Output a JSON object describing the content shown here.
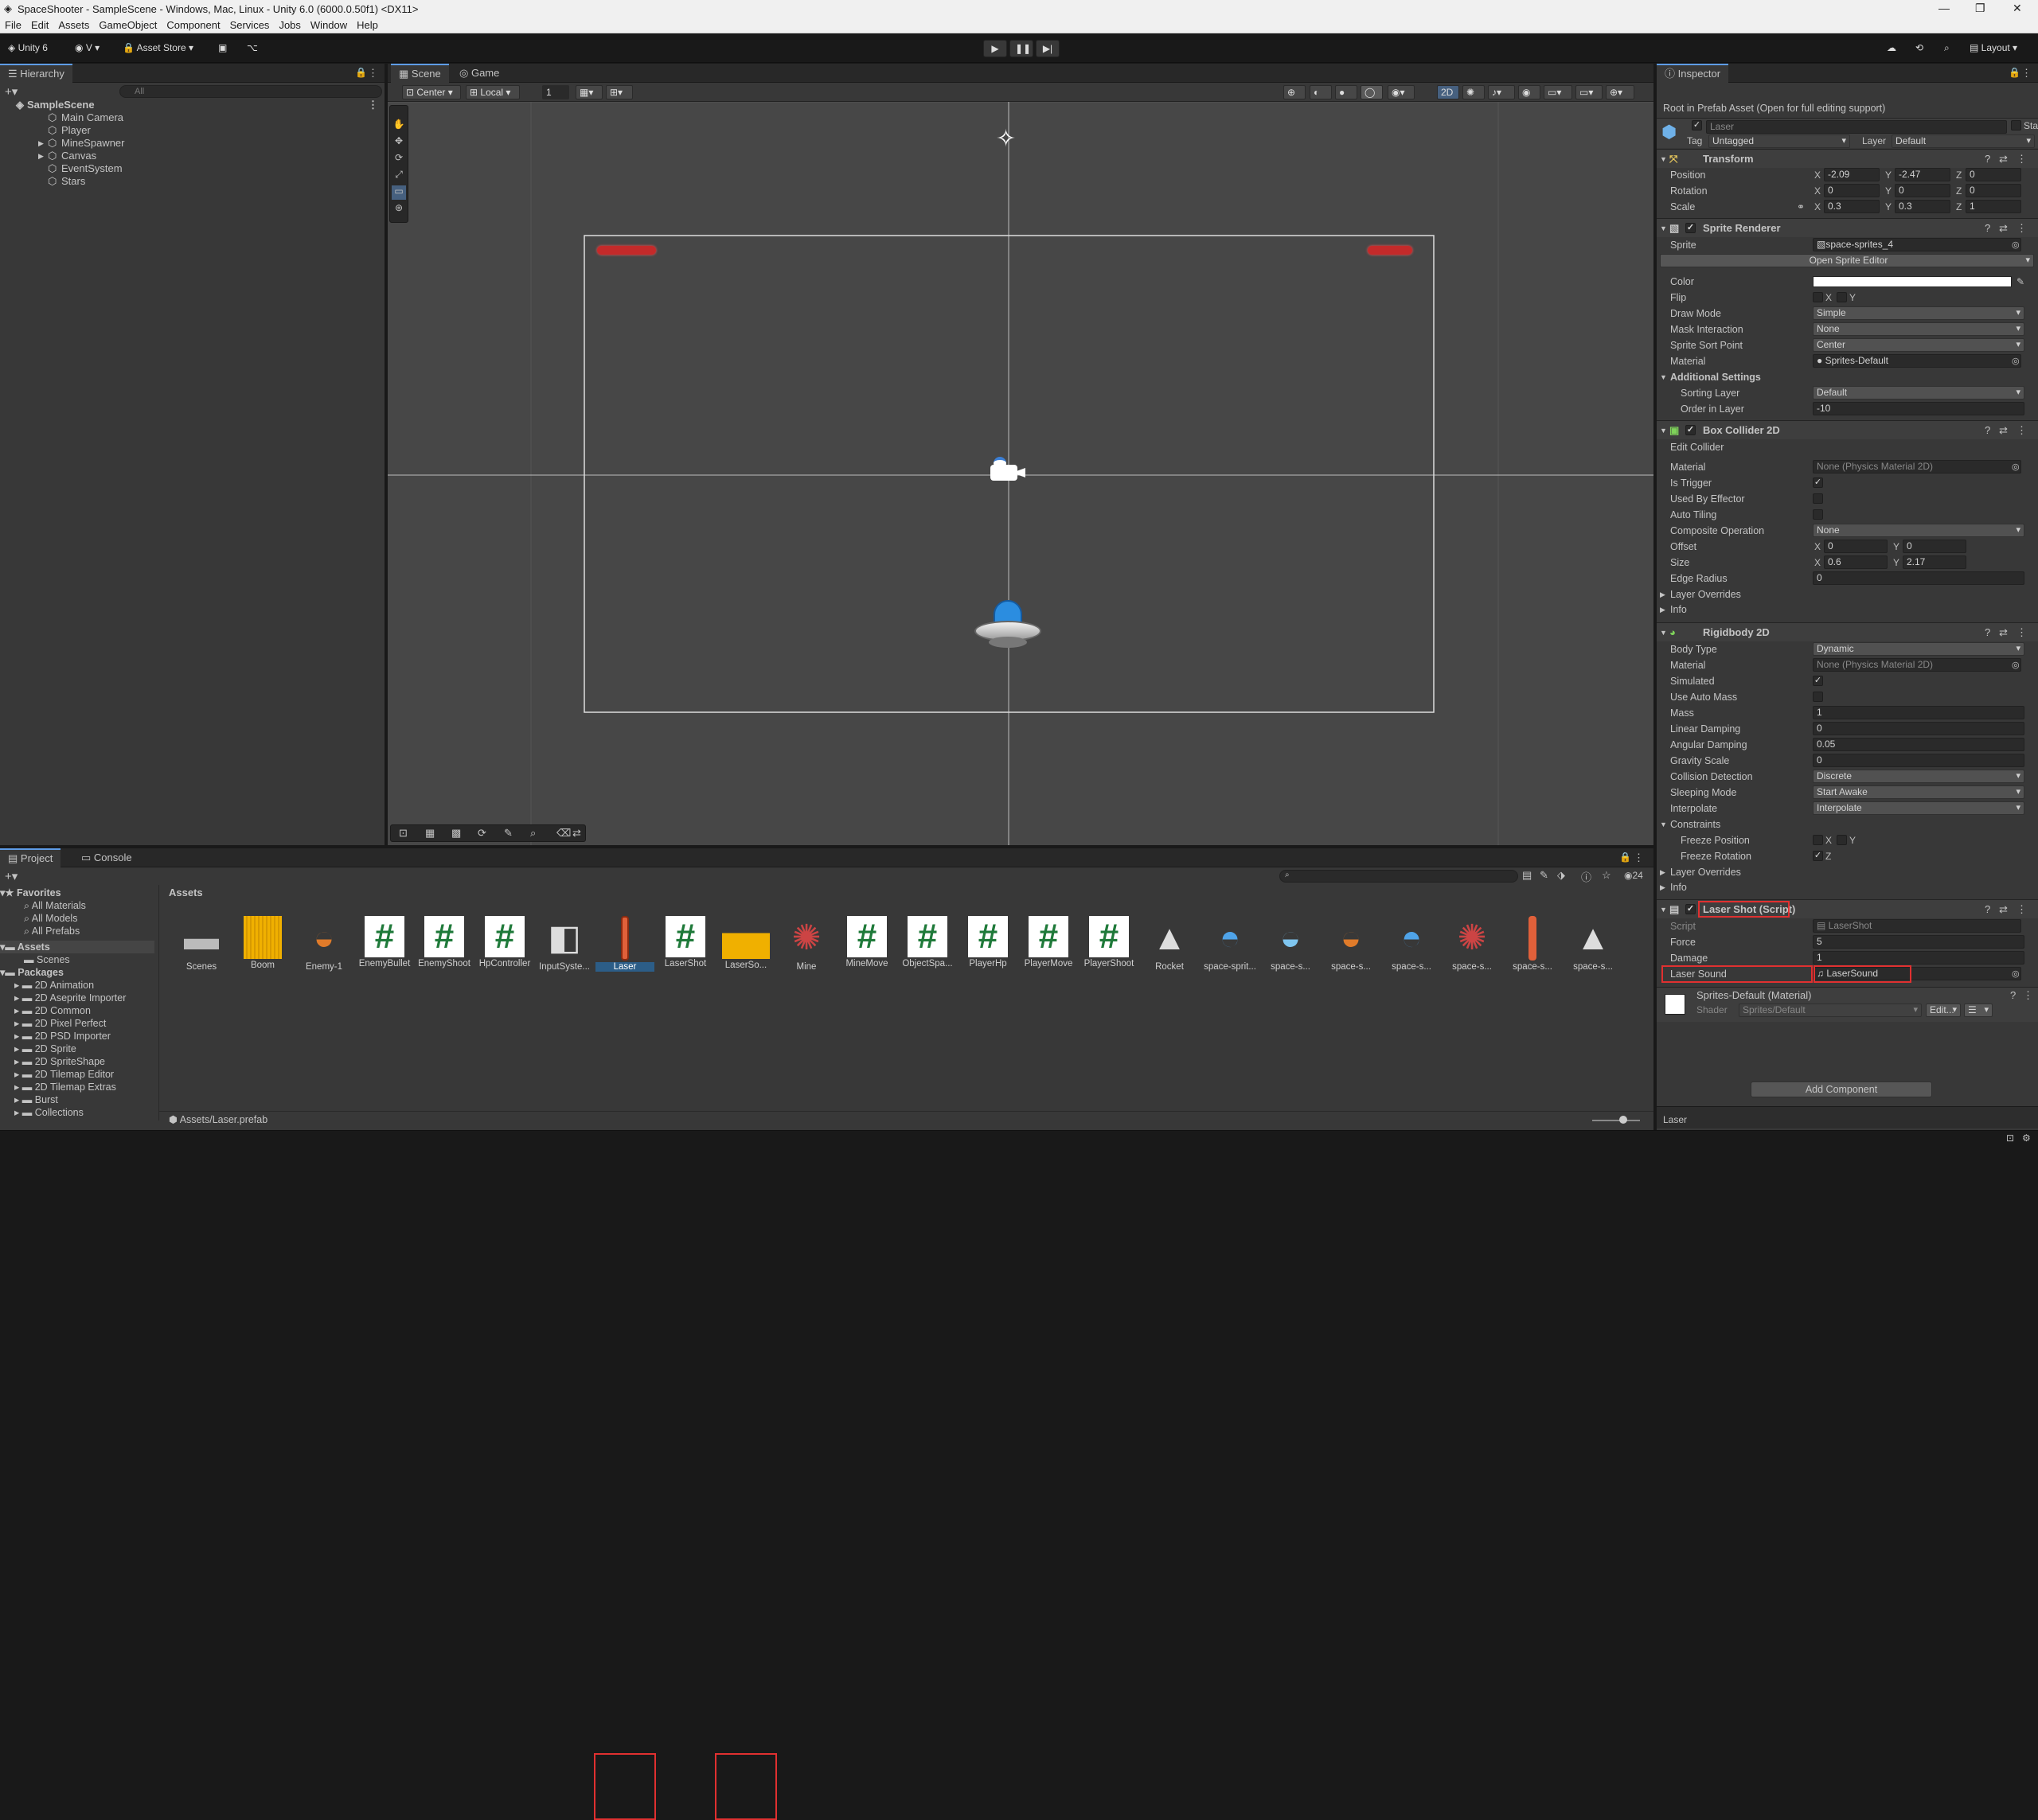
{
  "window": {
    "title": "SpaceShooter - SampleScene - Windows, Mac, Linux - Unity 6.0 (6000.0.50f1) <DX11>"
  },
  "menu": [
    "File",
    "Edit",
    "Assets",
    "GameObject",
    "Component",
    "Services",
    "Jobs",
    "Window",
    "Help"
  ],
  "toolbar": {
    "unity_label": "Unity 6",
    "account_label": "V",
    "asset_store_label": "Asset Store",
    "layout_label": "Layout"
  },
  "hierarchy": {
    "tab_label": "Hierarchy",
    "search_placeholder": "All",
    "scene_name": "SampleScene",
    "items": [
      "Main Camera",
      "Player",
      "MineSpawner",
      "Canvas",
      "EventSystem",
      "Stars"
    ]
  },
  "scene_view": {
    "tabs": [
      "Scene",
      "Game"
    ],
    "pivot_label": "Center",
    "space_label": "Local",
    "snap_value": "1",
    "mode_2d_label": "2D"
  },
  "inspector": {
    "tab_label": "Inspector",
    "prefab_notice": "Root in Prefab Asset (Open for full editing support)",
    "object_name": "Laser",
    "static_label": "Static",
    "tag_label": "Tag",
    "tag_value": "Untagged",
    "layer_label": "Layer",
    "layer_value": "Default",
    "transform": {
      "title": "Transform",
      "position": {
        "label": "Position",
        "x": "-2.09",
        "y": "-2.47",
        "z": "0"
      },
      "rotation": {
        "label": "Rotation",
        "x": "0",
        "y": "0",
        "z": "0"
      },
      "scale": {
        "label": "Scale",
        "x": "0.3",
        "y": "0.3",
        "z": "1"
      }
    },
    "sprite_renderer": {
      "title": "Sprite Renderer",
      "sprite_label": "Sprite",
      "sprite_value": "space-sprites_4",
      "open_editor": "Open Sprite Editor",
      "color_label": "Color",
      "flip_label": "Flip",
      "flip_x": "X",
      "flip_y": "Y",
      "draw_mode_label": "Draw Mode",
      "draw_mode": "Simple",
      "mask_label": "Mask Interaction",
      "mask": "None",
      "sort_point_label": "Sprite Sort Point",
      "sort_point": "Center",
      "material_label": "Material",
      "material": "Sprites-Default",
      "additional": "Additional Settings",
      "sorting_layer_label": "Sorting Layer",
      "sorting_layer": "Default",
      "order_label": "Order in Layer",
      "order": "-10"
    },
    "box_collider": {
      "title": "Box Collider 2D",
      "edit_collider": "Edit Collider",
      "material_label": "Material",
      "material": "None (Physics Material 2D)",
      "is_trigger": "Is Trigger",
      "used_by_effector": "Used By Effector",
      "auto_tiling": "Auto Tiling",
      "composite_label": "Composite Operation",
      "composite": "None",
      "offset_label": "Offset",
      "offset_x": "0",
      "offset_y": "0",
      "size_label": "Size",
      "size_x": "0.6",
      "size_y": "2.17",
      "edge_label": "Edge Radius",
      "edge": "0",
      "layer_overrides": "Layer Overrides",
      "info": "Info"
    },
    "rigidbody": {
      "title": "Rigidbody 2D",
      "body_type_label": "Body Type",
      "body_type": "Dynamic",
      "material_label": "Material",
      "material": "None (Physics Material 2D)",
      "simulated": "Simulated",
      "use_auto_mass": "Use Auto Mass",
      "mass_label": "Mass",
      "mass": "1",
      "linear_label": "Linear Damping",
      "linear": "0",
      "angular_label": "Angular Damping",
      "angular": "0.05",
      "gravity_label": "Gravity Scale",
      "gravity": "0",
      "collision_label": "Collision Detection",
      "collision": "Discrete",
      "sleeping_label": "Sleeping Mode",
      "sleeping": "Start Awake",
      "interpolate_label": "Interpolate",
      "interpolate": "Interpolate",
      "constraints": "Constraints",
      "freeze_pos": "Freeze Position",
      "freeze_rot": "Freeze Rotation",
      "x": "X",
      "y": "Y",
      "z": "Z",
      "layer_overrides": "Layer Overrides",
      "info": "Info"
    },
    "laser_shot": {
      "title": "Laser Shot (Script)",
      "script_label": "Script",
      "script": "LaserShot",
      "force_label": "Force",
      "force": "5",
      "damage_label": "Damage",
      "damage": "1",
      "sound_label": "Laser Sound",
      "sound": "LaserSound"
    },
    "material": {
      "title": "Sprites-Default (Material)",
      "shader_label": "Shader",
      "shader": "Sprites/Default",
      "edit": "Edit..."
    },
    "add_component": "Add Component",
    "footer": "Laser"
  },
  "project": {
    "tabs": [
      "Project",
      "Console"
    ],
    "favorites": "Favorites",
    "fav_items": [
      "All Materials",
      "All Models",
      "All Prefabs"
    ],
    "assets_root": "Assets",
    "asset_folders": [
      "Scenes"
    ],
    "packages": "Packages",
    "package_items": [
      "2D Animation",
      "2D Aseprite Importer",
      "2D Common",
      "2D Pixel Perfect",
      "2D PSD Importer",
      "2D Sprite",
      "2D SpriteShape",
      "2D Tilemap Editor",
      "2D Tilemap Extras",
      "Burst",
      "Collections"
    ],
    "breadcrumb": "Assets",
    "path": "Assets/Laser.prefab",
    "count": "24",
    "assets": [
      {
        "name": "Scenes",
        "icon": "folder-icon"
      },
      {
        "name": "Boom",
        "icon": "audio-icon"
      },
      {
        "name": "Enemy-1",
        "icon": "prefab-icon"
      },
      {
        "name": "EnemyBullet",
        "icon": "script-icon"
      },
      {
        "name": "EnemyShoot",
        "icon": "script-icon"
      },
      {
        "name": "HpController",
        "icon": "script-icon"
      },
      {
        "name": "InputSyste...",
        "icon": "input-icon"
      },
      {
        "name": "Laser",
        "icon": "prefab-icon"
      },
      {
        "name": "LaserShot",
        "icon": "script-icon"
      },
      {
        "name": "LaserSo...",
        "icon": "audio-icon"
      },
      {
        "name": "Mine",
        "icon": "prefab-icon"
      },
      {
        "name": "MineMove",
        "icon": "script-icon"
      },
      {
        "name": "ObjectSpa...",
        "icon": "script-icon"
      },
      {
        "name": "PlayerHp",
        "icon": "script-icon"
      },
      {
        "name": "PlayerMove",
        "icon": "script-icon"
      },
      {
        "name": "PlayerShoot",
        "icon": "script-icon"
      },
      {
        "name": "Rocket",
        "icon": "prefab-icon"
      },
      {
        "name": "space-sprit...",
        "icon": "sprite-icon"
      },
      {
        "name": "space-s...",
        "icon": "sprite-icon"
      },
      {
        "name": "space-s...",
        "icon": "sprite-icon"
      },
      {
        "name": "space-s...",
        "icon": "sprite-icon"
      },
      {
        "name": "space-s...",
        "icon": "sprite-icon"
      },
      {
        "name": "space-s...",
        "icon": "sprite-icon"
      },
      {
        "name": "space-s...",
        "icon": "sprite-icon"
      }
    ]
  },
  "colors": {
    "accent": "#5e9ce7",
    "highlight": "#e03030",
    "laser_red": "#c42a2a"
  }
}
